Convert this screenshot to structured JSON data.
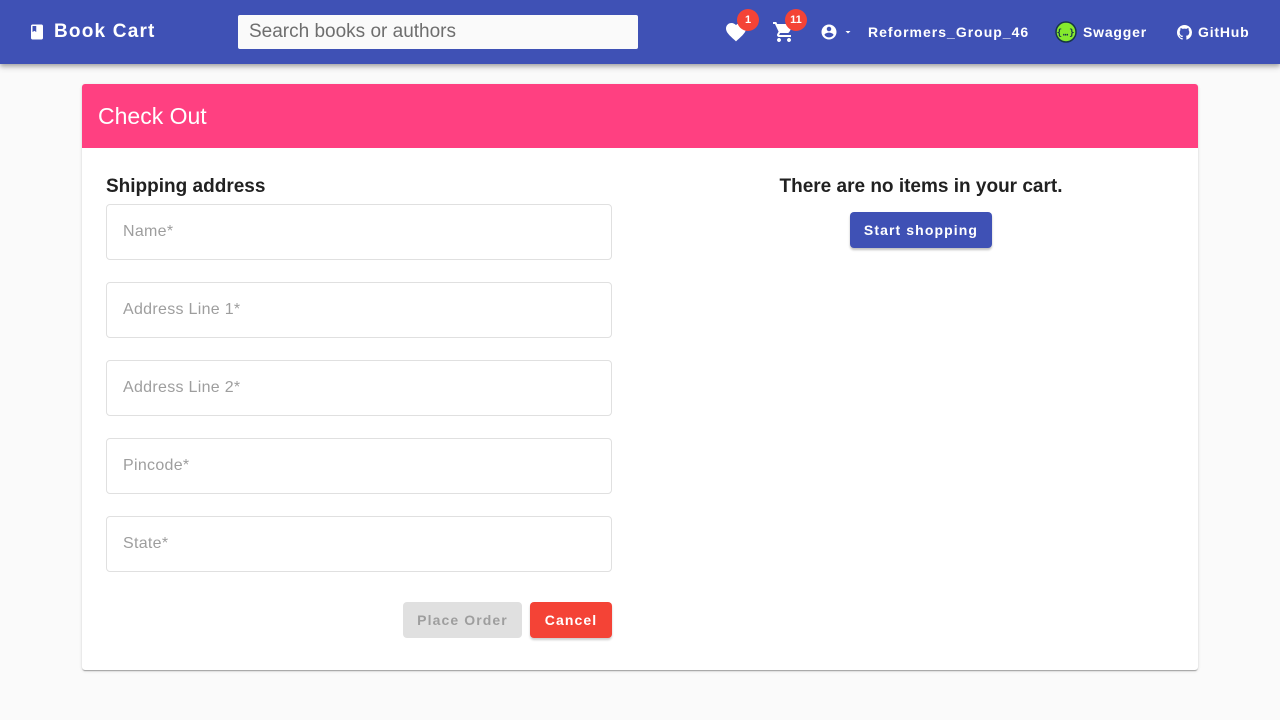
{
  "header": {
    "brand": "Book Cart",
    "search_placeholder": "Search books or authors",
    "wishlist_count": "1",
    "cart_count": "11",
    "username": "Reformers_Group_46",
    "swagger_label": "Swagger",
    "github_label": "GitHub",
    "icons": [
      "book-icon",
      "heart-icon",
      "cart-icon",
      "account-circle-icon",
      "caret-down-icon",
      "swagger-icon",
      "github-icon"
    ]
  },
  "checkout": {
    "title": "Check Out",
    "shipping_title": "Shipping address",
    "fields": {
      "name": {
        "placeholder": "Name*",
        "value": ""
      },
      "address1": {
        "placeholder": "Address Line 1*",
        "value": ""
      },
      "address2": {
        "placeholder": "Address Line 2*",
        "value": ""
      },
      "pincode": {
        "placeholder": "Pincode*",
        "value": ""
      },
      "state": {
        "placeholder": "State*",
        "value": ""
      }
    },
    "place_order_label": "Place Order",
    "cancel_label": "Cancel",
    "empty_cart_message": "There are no items in your cart.",
    "start_shopping_label": "Start shopping"
  },
  "colors": {
    "primary": "#3f51b5",
    "accent": "#ff4081",
    "warn": "#f44336",
    "background": "#fafafa"
  }
}
